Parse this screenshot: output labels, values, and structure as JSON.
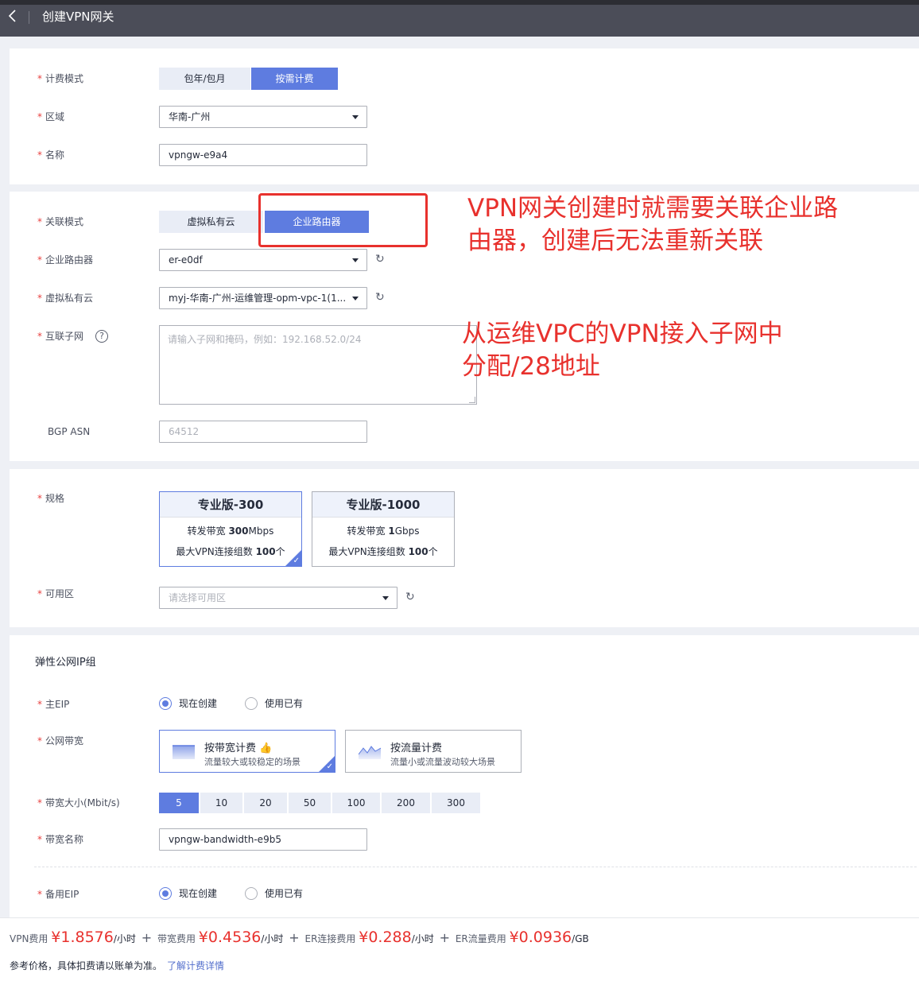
{
  "header": {
    "title": "创建VPN网关"
  },
  "billing": {
    "label": "计费模式",
    "options": [
      "包年/包月",
      "按需计费"
    ],
    "selected": "按需计费"
  },
  "region": {
    "label": "区域",
    "value": "华南-广州"
  },
  "name": {
    "label": "名称",
    "value": "vpngw-e9a4"
  },
  "association": {
    "label": "关联模式",
    "options": [
      "虚拟私有云",
      "企业路由器"
    ],
    "selected": "企业路由器"
  },
  "enterprise_router": {
    "label": "企业路由器",
    "value": "er-e0df"
  },
  "vpc": {
    "label": "虚拟私有云",
    "value": "myj-华南-广州-运维管理-opm-vpc-1(1..."
  },
  "interconnect_subnet": {
    "label": "互联子网",
    "placeholder": "请输入子网和掩码，例如：192.168.52.0/24"
  },
  "bgp_asn": {
    "label": "BGP ASN",
    "value": "64512"
  },
  "annotations": {
    "note1_line1": "VPN网关创建时就需要关联企业路",
    "note1_line2": "由器，创建后无法重新关联",
    "note2_line1": "从运维VPC的VPN接入子网中",
    "note2_line2": "分配/28地址"
  },
  "spec": {
    "label": "规格",
    "options": [
      {
        "title": "专业版-300",
        "bw_prefix": "转发带宽 ",
        "bw_value": "300",
        "bw_unit": "Mbps",
        "conn_prefix": "最大VPN连接组数 ",
        "conn_value": "100",
        "conn_unit": "个",
        "selected": true
      },
      {
        "title": "专业版-1000",
        "bw_prefix": "转发带宽 ",
        "bw_value": "1",
        "bw_unit": "Gbps",
        "conn_prefix": "最大VPN连接组数 ",
        "conn_value": "100",
        "conn_unit": "个",
        "selected": false
      }
    ]
  },
  "az": {
    "label": "可用区",
    "placeholder": "请选择可用区"
  },
  "eip": {
    "section_title": "弹性公网IP组",
    "primary_label": "主EIP",
    "create_now": "现在创建",
    "use_existing": "使用已有",
    "bandwidth_label": "公网带宽",
    "by_bandwidth_title": "按带宽计费",
    "by_bandwidth_sub": "流量较大或较稳定的场景",
    "by_traffic_title": "按流量计费",
    "by_traffic_sub": "流量小或流量波动较大场景",
    "size_label": "带宽大小(Mbit/s)",
    "sizes": [
      "5",
      "10",
      "20",
      "50",
      "100",
      "200",
      "300"
    ],
    "selected_size": "5",
    "bw_name_label": "带宽名称",
    "bw_name_value": "vpngw-bandwidth-e9b5",
    "backup_label": "备用EIP"
  },
  "footer": {
    "vpn_fee_label": "VPN费用",
    "vpn_fee": "¥1.8576",
    "per_hour": "/小时",
    "plus": "+",
    "bw_fee_label": "带宽费用",
    "bw_fee": "¥0.4536",
    "er_conn_label": "ER连接费用",
    "er_conn_fee": "¥0.288",
    "er_traffic_label": "ER流量费用",
    "er_traffic_fee": "¥0.0936",
    "per_gb": "/GB",
    "note": "参考价格，具体扣费请以账单为准。",
    "link": "了解计费详情"
  },
  "colors": {
    "accent": "#5e7ce0",
    "required": "#e8413f",
    "annotation": "#e8312d",
    "price": "#e8312d"
  }
}
